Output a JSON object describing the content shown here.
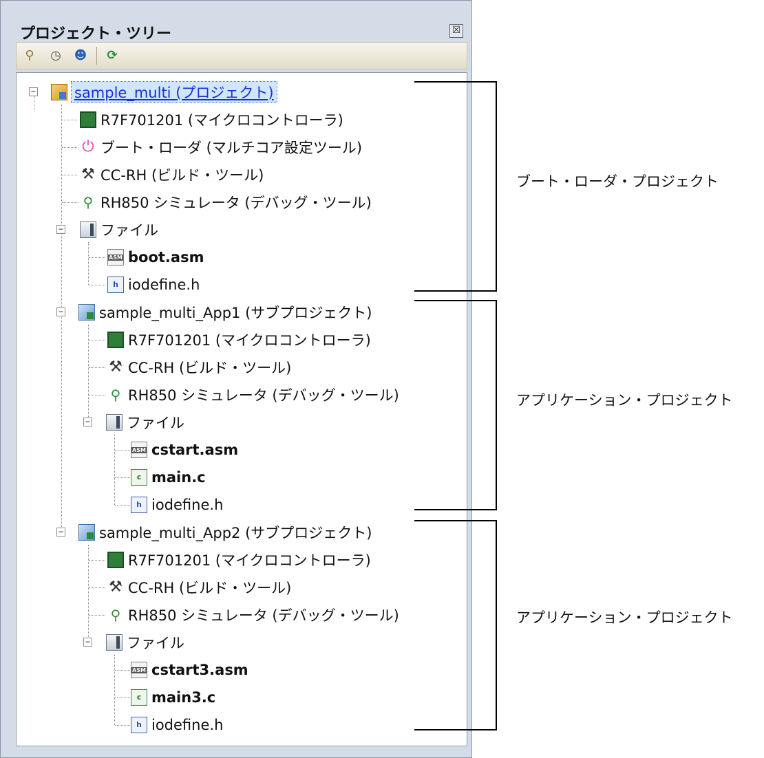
{
  "panel": {
    "title": "プロジェクト・ツリー",
    "close_glyph": "☒",
    "toolbar": [
      {
        "icon": "build-icon",
        "glyph": "⚲"
      },
      {
        "icon": "history-icon",
        "glyph": "◷"
      },
      {
        "icon": "user-icon",
        "glyph": "☻"
      },
      {
        "icon": "refresh-icon",
        "glyph": "⟳"
      }
    ]
  },
  "tree": {
    "root": {
      "label": "sample_multi (プロジェクト)",
      "expander": "−"
    },
    "boot": {
      "mcu": "R7F701201 (マイクロコントローラ)",
      "bootloader": "ブート・ローダ (マルチコア設定ツール)",
      "build": "CC-RH (ビルド・ツール)",
      "debug": "RH850 シミュレータ (デバッグ・ツール)",
      "folder": "ファイル",
      "files": [
        "boot.asm",
        "iodefine.h"
      ]
    },
    "app1": {
      "label": "sample_multi_App1 (サブプロジェクト)",
      "mcu": "R7F701201 (マイクロコントローラ)",
      "build": "CC-RH (ビルド・ツール)",
      "debug": "RH850 シミュレータ (デバッグ・ツール)",
      "folder": "ファイル",
      "files": [
        "cstart.asm",
        "main.c",
        "iodefine.h"
      ]
    },
    "app2": {
      "label": "sample_multi_App2 (サブプロジェクト)",
      "mcu": "R7F701201 (マイクロコントローラ)",
      "build": "CC-RH (ビルド・ツール)",
      "debug": "RH850 シミュレータ (デバッグ・ツール)",
      "folder": "ファイル",
      "files": [
        "cstart3.asm",
        "main3.c",
        "iodefine.h"
      ]
    }
  },
  "annotations": [
    "ブート・ローダ・プロジェクト",
    "アプリケーション・プロジェクト",
    "アプリケーション・プロジェクト"
  ]
}
